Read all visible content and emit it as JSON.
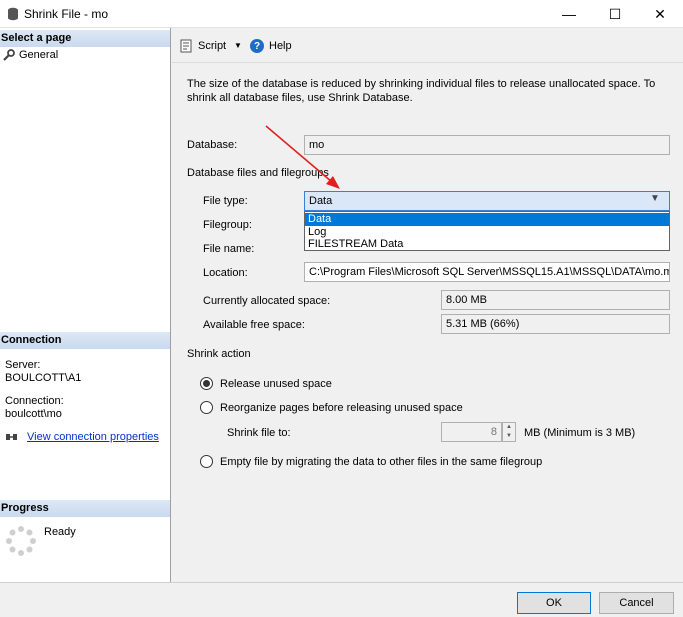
{
  "window": {
    "title": "Shrink File - mo",
    "minimize": "—",
    "maximize": "☐",
    "close": "✕"
  },
  "left": {
    "select_page": "Select a page",
    "general": "General",
    "connection_head": "Connection",
    "server_label": "Server:",
    "server_value": "BOULCOTT\\A1",
    "connection_label": "Connection:",
    "connection_value": "boulcott\\mo",
    "view_conn": "View connection properties",
    "progress_head": "Progress",
    "ready": "Ready"
  },
  "toolbar": {
    "script": "Script",
    "script_dd": "▼",
    "help": "Help",
    "help_glyph": "?"
  },
  "main": {
    "description": "The size of the database is reduced by shrinking individual files to release unallocated space. To shrink all database files, use Shrink Database.",
    "database_label": "Database:",
    "database_value": "mo",
    "files_label": "Database files and filegroups",
    "filetype_label": "File type:",
    "filetype_value": "Data",
    "filetype_options": [
      "Data",
      "Log",
      "FILESTREAM Data"
    ],
    "filegroup_label": "Filegroup:",
    "filename_label": "File name:",
    "location_label": "Location:",
    "location_value": "C:\\Program Files\\Microsoft SQL Server\\MSSQL15.A1\\MSSQL\\DATA\\mo.m",
    "alloc_label": "Currently allocated space:",
    "alloc_value": "8.00 MB",
    "free_label": "Available free space:",
    "free_value": "5.31 MB (66%)",
    "shrink_action": "Shrink action",
    "release_label": "Release unused space",
    "reorg_label": "Reorganize pages before releasing unused space",
    "shrinkto_label": "Shrink file to:",
    "shrinkto_value": "8",
    "shrinkto_unit": "MB (Minimum is 3 MB)",
    "empty_label": "Empty file by migrating the data to other files in the same filegroup",
    "selected_action": "release"
  },
  "buttons": {
    "ok": "OK",
    "cancel": "Cancel"
  },
  "colors": {
    "accent": "#0078d7",
    "arrow": "#e02020",
    "link": "#0033cc"
  }
}
